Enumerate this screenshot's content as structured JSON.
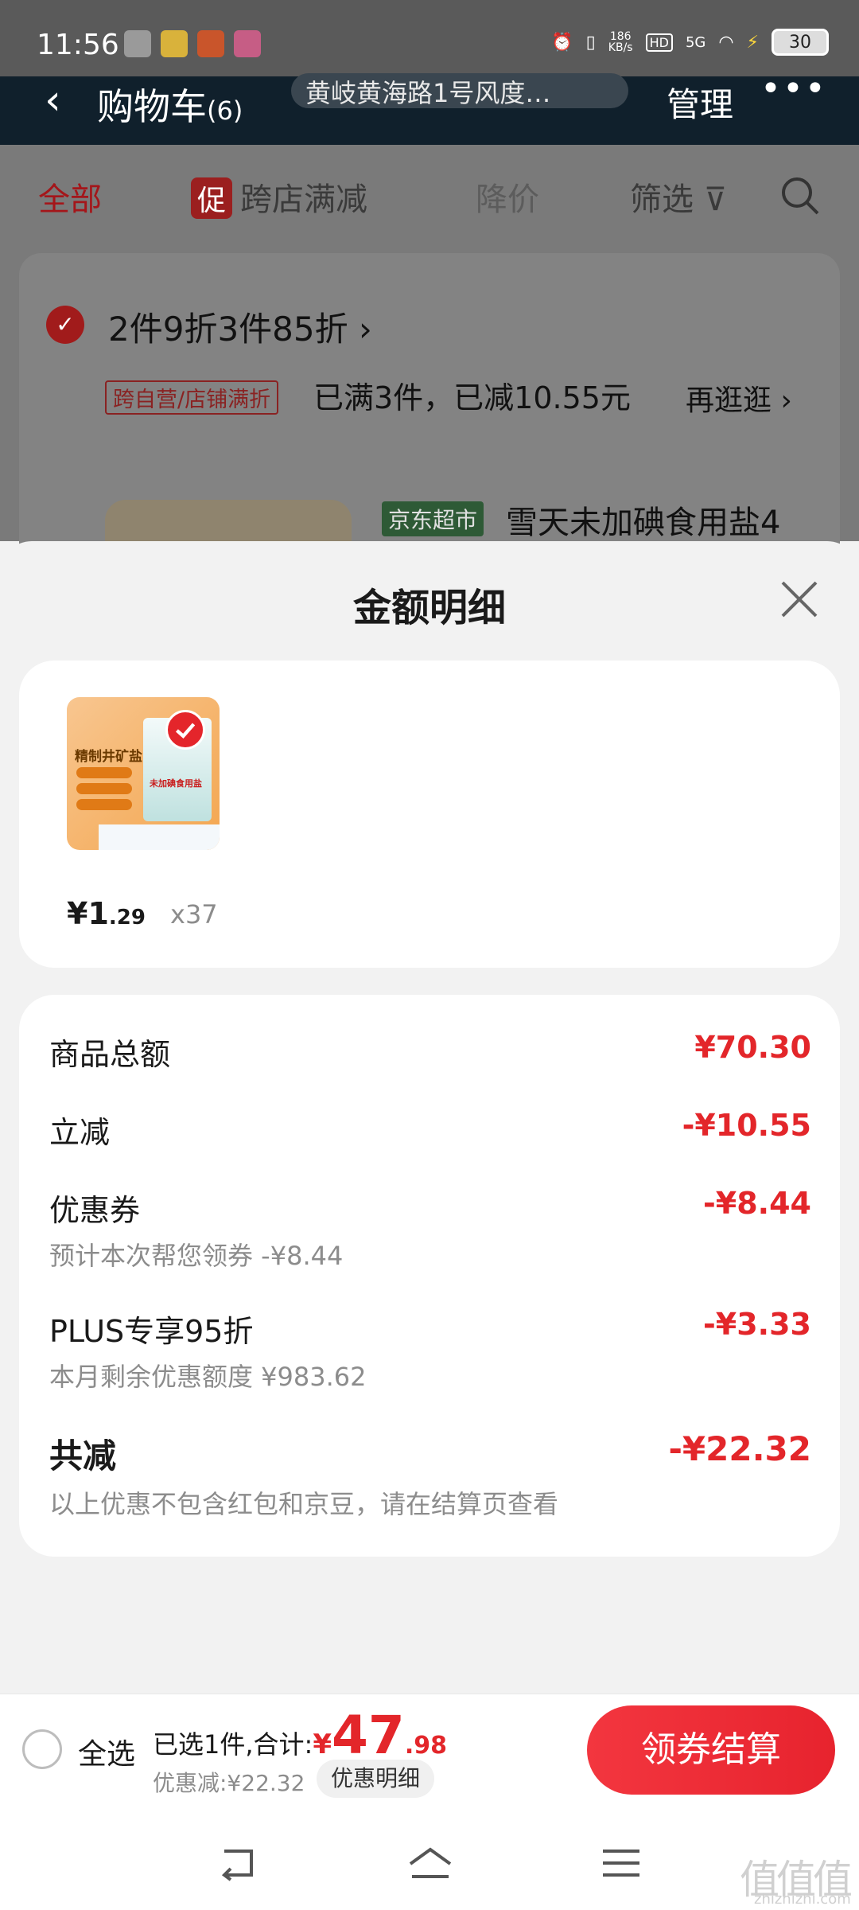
{
  "status_bar": {
    "time": "11:56",
    "net_speed_value": "186",
    "net_speed_unit": "KB/s",
    "hd": "HD",
    "signal": "5G",
    "battery": "30"
  },
  "header": {
    "back_icon": "chevron-left-icon",
    "title": "购物车",
    "count": "(6)",
    "address": "黄岐黄海路1号风度…",
    "manage": "管理",
    "more": "•••"
  },
  "filters": {
    "all": "全部",
    "promo_tag": "促",
    "cross_store": "跨店满减",
    "price_drop": "降价",
    "filter": "筛选"
  },
  "shop": {
    "deal": "2件9折3件85折 ›",
    "promo_label": "跨自营/店铺满折",
    "met": "已满3件，已减10.55元",
    "browse_more": "再逛逛 ›",
    "market_tag": "京东超市",
    "product_name": "雪天未加碘食用盐4"
  },
  "sheet": {
    "title": "金额明细",
    "product": {
      "image_label": "精制井矿盐",
      "bag_label": "未加碘食用盐",
      "price_symbol": "¥",
      "price_int": "1",
      "price_dec": ".29",
      "qty": "x37"
    },
    "rows": {
      "total_label": "商品总额",
      "total_value": "¥70.30",
      "instant_label": "立减",
      "instant_value": "-¥10.55",
      "coupon_label": "优惠券",
      "coupon_value": "-¥8.44",
      "coupon_sub": "预计本次帮您领券 -¥8.44",
      "plus_label": "PLUS专享95折",
      "plus_value": "-¥3.33",
      "plus_sub": "本月剩余优惠额度 ¥983.62",
      "sum_label": "共减",
      "sum_value": "-¥22.32",
      "sum_sub": "以上优惠不包含红包和京豆，请在结算页查看"
    }
  },
  "bottom_bar": {
    "select_all": "全选",
    "selected_text": "已选1件,合计:",
    "currency": "¥",
    "total_int": "47",
    "total_dec": ".98",
    "discount": "优惠减:¥22.32",
    "detail_button": "优惠明细",
    "checkout": "领券结算"
  },
  "watermark": {
    "main": "值值值",
    "sub": "zhizhizhi.com"
  },
  "colors": {
    "accent_red": "#e3262a",
    "header_dark": "#10202c"
  }
}
